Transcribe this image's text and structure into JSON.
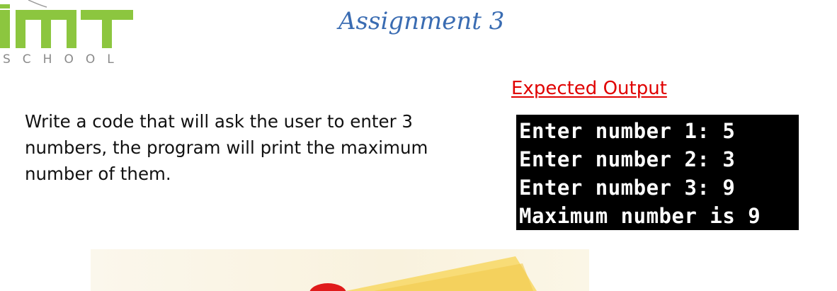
{
  "logo": {
    "letters": "IMT",
    "subtitle": "SCHOOL"
  },
  "title": "Assignment 3",
  "expected_output_label": "Expected Output",
  "task_text": "Write a code that will ask the user to enter 3 numbers, the program will print the maximum number of them.",
  "console": {
    "lines": [
      "Enter number 1: 5",
      "Enter number 2: 3",
      "Enter number 3: 9",
      "Maximum number is 9"
    ]
  },
  "colors": {
    "logo_green": "#8cc63f",
    "title_blue": "#3a6cb2",
    "label_red": "#e00000",
    "console_bg": "#000000",
    "console_fg": "#ffffff"
  }
}
